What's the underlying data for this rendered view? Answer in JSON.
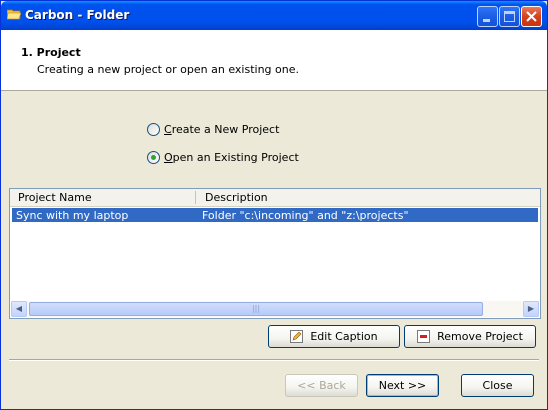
{
  "window": {
    "title": "Carbon - Folder"
  },
  "header": {
    "title": "1. Project",
    "subtitle": "Creating a new project or open an existing one."
  },
  "options": [
    {
      "label": "Create a New Project",
      "selected": false
    },
    {
      "label": "Open an Existing Project",
      "selected": true
    }
  ],
  "projects_table": {
    "columns": [
      "Project Name",
      "Description"
    ],
    "rows": [
      {
        "name": "Sync with my laptop",
        "description": "Folder \"c:\\incoming\" and \"z:\\projects\"",
        "selected": true
      }
    ]
  },
  "actions": {
    "edit_caption": "Edit Caption",
    "remove_project": "Remove Project"
  },
  "footer": {
    "back": "<< Back",
    "next": "Next >>",
    "close": "Close"
  },
  "icons": {
    "app": "folder-icon",
    "minimize": "minimize-icon",
    "maximize": "maximize-icon",
    "close": "close-icon",
    "edit": "pencil-icon",
    "remove": "remove-icon"
  },
  "colors": {
    "title_bar": "#0054e3",
    "selection": "#316ac5",
    "window_bg": "#ece9d8"
  }
}
